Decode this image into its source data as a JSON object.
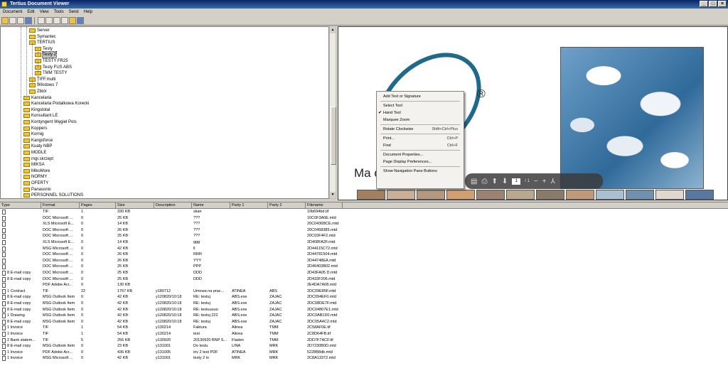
{
  "window": {
    "title": "Tertius Document Viewer",
    "minimize": "_",
    "maximize": "□",
    "close": "×"
  },
  "menu": [
    "Document",
    "Edit",
    "View",
    "Tools",
    "Send",
    "Help"
  ],
  "toolbar": {
    "icons": [
      "folder-icon",
      "save-icon",
      "print-icon",
      "find-icon",
      "cut-icon",
      "copy-icon",
      "paste-icon",
      "delete-icon",
      "properties-icon",
      "grid-icon"
    ]
  },
  "tree": {
    "items": [
      {
        "label": "Server",
        "depth": 3
      },
      {
        "label": "Symantec",
        "depth": 3
      },
      {
        "label": "TERTIUS",
        "depth": 3
      },
      {
        "label": "Testy",
        "depth": 4
      },
      {
        "label": "Testy 2",
        "depth": 4,
        "selected": true
      },
      {
        "label": "TESTY FR25",
        "depth": 4
      },
      {
        "label": "Testy FUS ABS",
        "depth": 4
      },
      {
        "label": "TMM TESTY",
        "depth": 4
      },
      {
        "label": "TIFF.multi",
        "depth": 3
      },
      {
        "label": "Windows 7",
        "depth": 3
      },
      {
        "label": "Zbiór",
        "depth": 3
      },
      {
        "label": "Kancelaria",
        "depth": 2
      },
      {
        "label": "Kancelaria Podatkowa Korecki",
        "depth": 2
      },
      {
        "label": "Kingstotal",
        "depth": 2
      },
      {
        "label": "Konsultant LE",
        "depth": 2
      },
      {
        "label": "Kontyngent Węgiel Pols",
        "depth": 2
      },
      {
        "label": "Koppers",
        "depth": 2
      },
      {
        "label": "Kornig",
        "depth": 2
      },
      {
        "label": "Kangsforce",
        "depth": 2
      },
      {
        "label": "Kuaty NBP",
        "depth": 2
      },
      {
        "label": "MODLE",
        "depth": 2
      },
      {
        "label": "mgr.skrzept",
        "depth": 2
      },
      {
        "label": "MIKSA",
        "depth": 2
      },
      {
        "label": "MikoMore",
        "depth": 2
      },
      {
        "label": "NORMY",
        "depth": 2
      },
      {
        "label": "OFERTY",
        "depth": 2
      },
      {
        "label": "Panasonic",
        "depth": 2
      },
      {
        "label": "PERSONNEL SOLUTIONS",
        "depth": 2
      }
    ]
  },
  "preview": {
    "text": "Ma               de flakes 47%",
    "reg_mark": "®",
    "swatch_colors": [
      "#a08060",
      "#c8b098",
      "#b49880",
      "#d0a070",
      "#9c8270",
      "#b8a890",
      "#8a7a6a",
      "#c09a78",
      "#a8c0d0",
      "#7090b0",
      "#e0d8d0",
      "#5878a0"
    ],
    "nav_page": "1",
    "nav_of": "/ 1"
  },
  "context_menu": {
    "items": [
      {
        "label": "Add Text or Signature",
        "shortcut": ""
      },
      {
        "sep": true
      },
      {
        "label": "Select Tool",
        "shortcut": ""
      },
      {
        "label": "Hand Tool",
        "shortcut": "",
        "checked": true
      },
      {
        "label": "Marquee Zoom",
        "shortcut": ""
      },
      {
        "sep": true
      },
      {
        "label": "Rotate Clockwise",
        "shortcut": "Shift+Ctrl+Plus"
      },
      {
        "sep": true
      },
      {
        "label": "Print...",
        "shortcut": "Ctrl+P"
      },
      {
        "label": "Find",
        "shortcut": "Ctrl+F"
      },
      {
        "sep": true
      },
      {
        "label": "Document Properties...",
        "shortcut": ""
      },
      {
        "label": "Page Display Preferences...",
        "shortcut": ""
      },
      {
        "sep": true
      },
      {
        "label": "Show Navigation Pane Buttons",
        "shortcut": ""
      }
    ]
  },
  "grid": {
    "columns": [
      "Type",
      "Format",
      "Pages",
      "Size",
      "Description",
      "Name",
      "Party 1",
      "Party 2",
      "Filename"
    ],
    "rows": [
      [
        "",
        "TIF",
        "1",
        "330 KB",
        "",
        "skan",
        "",
        "",
        "10b694bd.tif"
      ],
      [
        "",
        "DOC Microsoft ...",
        "0",
        "25 KB",
        "",
        "???",
        "",
        "",
        "10C0F3A0E.mtd"
      ],
      [
        "",
        "XLS Microsoft E...",
        "0",
        "14 KB",
        "",
        "???",
        "",
        "",
        "20C0436BCE.mtd"
      ],
      [
        "",
        "DOC Microsoft ...",
        "0",
        "26 KB",
        "",
        "???",
        "",
        "",
        "20C0458385.mtd"
      ],
      [
        "",
        "DOC Microsoft ...",
        "0",
        "25 KB",
        "",
        "???",
        "",
        "",
        "20C03F4F2.mtd"
      ],
      [
        "",
        "XLS Microsoft E...",
        "0",
        "14 KB",
        "",
        "ggg",
        "",
        "",
        "2D408FA2F.mtd"
      ],
      [
        "",
        "MSG Microsoft ...",
        "0",
        "42 KB",
        "",
        "ll",
        "",
        "",
        "2D44115C72.mtd"
      ],
      [
        "",
        "DOC Microsoft ...",
        "0",
        "26 KB",
        "",
        "RRR",
        "",
        "",
        "2D44781504.mtd"
      ],
      [
        "",
        "DOC Microsoft ...",
        "0",
        "26 KB",
        "",
        "YYY",
        "",
        "",
        "2D44748EA.mtd"
      ],
      [
        "",
        "DOC Microsoft ...",
        "0",
        "25 KB",
        "",
        "PPP",
        "",
        "",
        "2D46403B02.mtd"
      ],
      [
        "8 E-mail copy",
        "DOC Microsoft ...",
        "0",
        "25 KB",
        "",
        "DDD",
        "",
        "",
        "2D43FA05 D.mtd"
      ],
      [
        "8 E-mail copy",
        "DOC Microsoft ...",
        "0",
        "25 KB",
        "",
        "DDD",
        "",
        "",
        "2D433F206.mtd"
      ],
      [
        "",
        "PDF Adobe Acr...",
        "0",
        "130 KB",
        "",
        "",
        "",
        "",
        "2E4DA7A08.mtd"
      ],
      [
        "1 Contract",
        "TIF",
        "22",
        "1767 KB",
        "y180712",
        "Umowa na prac...",
        "ATINEA",
        "ABS",
        "2DC09E85F.mtd"
      ],
      [
        "8 E-mail copy",
        "MSG Outlook Item",
        "0",
        "42 KB",
        "y120820/10:18",
        "RE: testuj",
        "ABS.exe",
        "ZAJAC",
        "2DC094EF0.mtd"
      ],
      [
        "8 E-mail copy",
        "MSG Outlook Item",
        "0",
        "42 KB",
        "y120820/10:18",
        "RE: testuj",
        "ABS.exe",
        "ZAJAC",
        "2DC08DE7F.mtd"
      ],
      [
        "8 E-mail copy",
        "MSG Outlook Item",
        "0",
        "42 KB",
        "y120820/10:18",
        "RE: testuuuuu",
        "ABS.exe",
        "ZAJAC",
        "2DC04807E1.mtd"
      ],
      [
        "1 Drawing",
        "MSG Outlook Item",
        "0",
        "42 KB",
        "y120820/10:18",
        "RE: testuj 222",
        "ABS.exe",
        "ZAJAC",
        "2DC0AB1D0.mtd"
      ],
      [
        "8 E-mail copy",
        "MSG Outlook Item",
        "0",
        "42 KB",
        "y120820/10:18",
        "RE: testuj",
        "ABS.exe",
        "ZAJAC",
        "2DC05A4C2.mtd"
      ],
      [
        "1 Invoice",
        "TIF",
        "1",
        "54 KB",
        "y130214",
        "Faktura",
        "Alinea",
        "TMM",
        "2C58AF0E.tif"
      ],
      [
        "1 Invoice",
        "TIF",
        "1",
        "54 KB",
        "y130214",
        "test",
        "Alinea",
        "TMM",
        "2C8D64FB.tif"
      ],
      [
        "2 Bank statem...",
        "TIF",
        "5",
        "256 KB",
        "y130920",
        "20130920 BNP S...",
        "Fladen",
        "TMM",
        "2DD7F7ACF.tif"
      ],
      [
        "8 E-mail copy",
        "MSG Outlook Item",
        "0",
        "23 KB",
        "y131001",
        "Do testu",
        "LINA",
        "MRK",
        "2D7230B0D.mtd"
      ],
      [
        "1 Invoice",
        "PDF Adobe Acr...",
        "0",
        "436 KB",
        "y131005",
        "inv 2 test PDF",
        "ATINEA",
        "MRK",
        "5228B8db.mtd"
      ],
      [
        "1 Invoice",
        "MSG Microsoft ...",
        "0",
        "42 KB",
        "y131001",
        "testy 2 in",
        "MRK",
        "MRK",
        "2C8A13372.mtd"
      ]
    ]
  }
}
